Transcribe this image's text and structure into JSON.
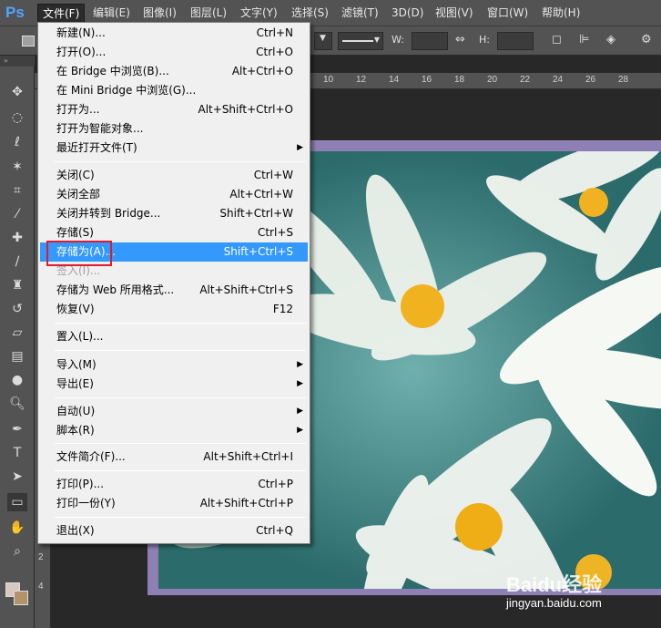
{
  "app": {
    "logo": "Ps"
  },
  "menubar": {
    "items": [
      {
        "label": "文件(F)"
      },
      {
        "label": "编辑(E)"
      },
      {
        "label": "图像(I)"
      },
      {
        "label": "图层(L)"
      },
      {
        "label": "文字(Y)"
      },
      {
        "label": "选择(S)"
      },
      {
        "label": "滤镜(T)"
      },
      {
        "label": "3D(D)"
      },
      {
        "label": "视图(V)"
      },
      {
        "label": "窗口(W)"
      },
      {
        "label": "帮助(H)"
      }
    ]
  },
  "optionsbar": {
    "w_label": "W:",
    "h_label": "H:"
  },
  "ruler": {
    "top": [
      "10",
      "12",
      "14",
      "16",
      "18",
      "20",
      "22",
      "24",
      "26",
      "28"
    ],
    "left": [
      "2",
      "4"
    ]
  },
  "file_menu": {
    "items": [
      {
        "label": "新建(N)...",
        "shortcut": "Ctrl+N"
      },
      {
        "label": "打开(O)...",
        "shortcut": "Ctrl+O"
      },
      {
        "label": "在 Bridge 中浏览(B)...",
        "shortcut": "Alt+Ctrl+O"
      },
      {
        "label": "在 Mini Bridge 中浏览(G)...",
        "shortcut": ""
      },
      {
        "label": "打开为...",
        "shortcut": "Alt+Shift+Ctrl+O"
      },
      {
        "label": "打开为智能对象...",
        "shortcut": ""
      },
      {
        "label": "最近打开文件(T)",
        "shortcut": ""
      },
      {
        "label": "关闭(C)",
        "shortcut": "Ctrl+W"
      },
      {
        "label": "关闭全部",
        "shortcut": "Alt+Ctrl+W"
      },
      {
        "label": "关闭并转到 Bridge...",
        "shortcut": "Shift+Ctrl+W"
      },
      {
        "label": "存储(S)",
        "shortcut": "Ctrl+S"
      },
      {
        "label": "存储为(A)...",
        "shortcut": "Shift+Ctrl+S"
      },
      {
        "label": "签入(I)...",
        "shortcut": ""
      },
      {
        "label": "存储为 Web 所用格式...",
        "shortcut": "Alt+Shift+Ctrl+S"
      },
      {
        "label": "恢复(V)",
        "shortcut": "F12"
      },
      {
        "label": "置入(L)...",
        "shortcut": ""
      },
      {
        "label": "导入(M)",
        "shortcut": ""
      },
      {
        "label": "导出(E)",
        "shortcut": ""
      },
      {
        "label": "自动(U)",
        "shortcut": ""
      },
      {
        "label": "脚本(R)",
        "shortcut": ""
      },
      {
        "label": "文件简介(F)...",
        "shortcut": "Alt+Shift+Ctrl+I"
      },
      {
        "label": "打印(P)...",
        "shortcut": "Ctrl+P"
      },
      {
        "label": "打印一份(Y)",
        "shortcut": "Alt+Shift+Ctrl+P"
      },
      {
        "label": "退出(X)",
        "shortcut": "Ctrl+Q"
      }
    ]
  },
  "watermark": {
    "logo": "Baidu经验",
    "url": "jingyan.baidu.com"
  },
  "colors": {
    "highlight": "#3399ff",
    "annotation_box": "#e01c2c",
    "foreground": "#d9c8bf",
    "background": "#b2936c"
  }
}
